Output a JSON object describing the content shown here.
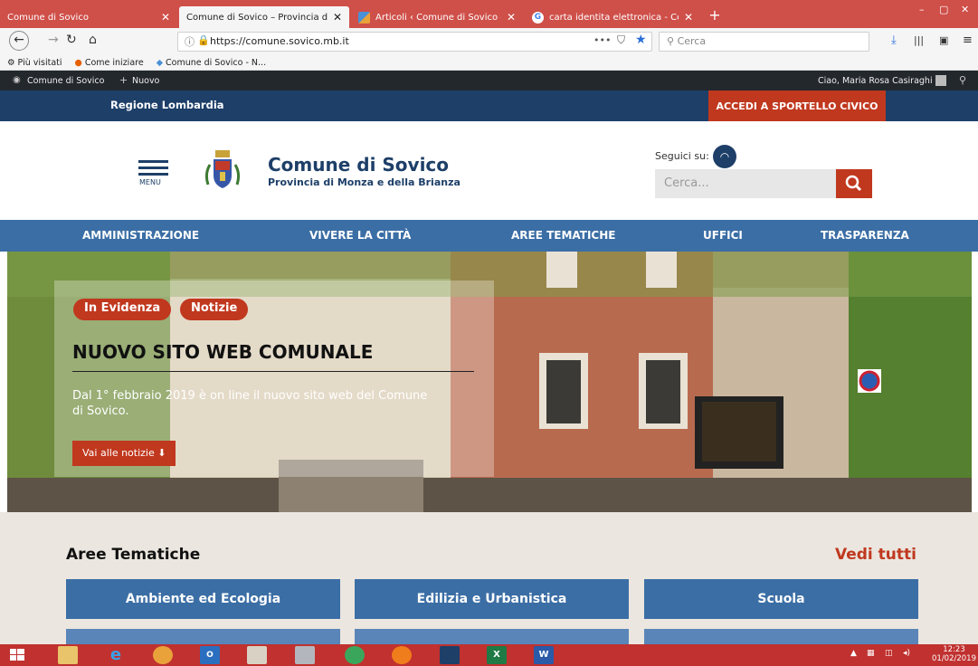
{
  "browser": {
    "tabs": [
      {
        "title": "Comune di Sovico",
        "active": false
      },
      {
        "title": "Comune di Sovico – Provincia di M",
        "active": true
      },
      {
        "title": "Articoli ‹ Comune di Sovico —",
        "active": false
      },
      {
        "title": "carta identita elettronica - Cen",
        "active": false
      }
    ],
    "url": "https://comune.sovico.mb.it",
    "search_placeholder": "Cerca",
    "bookmarks": [
      "Più visitati",
      "Come iniziare",
      "Comune di Sovico - N..."
    ]
  },
  "adminbar": {
    "site": "Comune di Sovico",
    "new": "Nuovo",
    "user": "Ciao, Maria Rosa Casiraghi"
  },
  "topbar": {
    "region": "Regione Lombardia",
    "sportello": "ACCEDI A SPORTELLO CIVICO"
  },
  "header": {
    "menu_label": "MENU",
    "title": "Comune di Sovico",
    "subtitle": "Provincia di Monza e della Brianza",
    "follow_label": "Seguici su:",
    "search_placeholder": "Cerca..."
  },
  "nav": [
    "AMMINISTRAZIONE",
    "VIVERE LA CITTÀ",
    "AREE TEMATICHE",
    "UFFICI",
    "TRASPARENZA"
  ],
  "hero": {
    "tags": [
      "In Evidenza",
      "Notizie"
    ],
    "title": "NUOVO SITO WEB COMUNALE",
    "text": "Dal 1° febbraio 2019 è on line il nuovo sito web del Comune di Sovico.",
    "button": "Vai alle notizie"
  },
  "areas": {
    "title": "Aree Tematiche",
    "see_all": "Vedi tutti",
    "items": [
      "Ambiente ed Ecologia",
      "Edilizia e Urbanistica",
      "Scuola"
    ]
  },
  "taskbar": {
    "time": "12:23",
    "date": "01/02/2019"
  },
  "colors": {
    "navy": "#1d3f68",
    "blue": "#3b6ea5",
    "red": "#c0381e",
    "firefox_tab": "#cf4f49"
  }
}
